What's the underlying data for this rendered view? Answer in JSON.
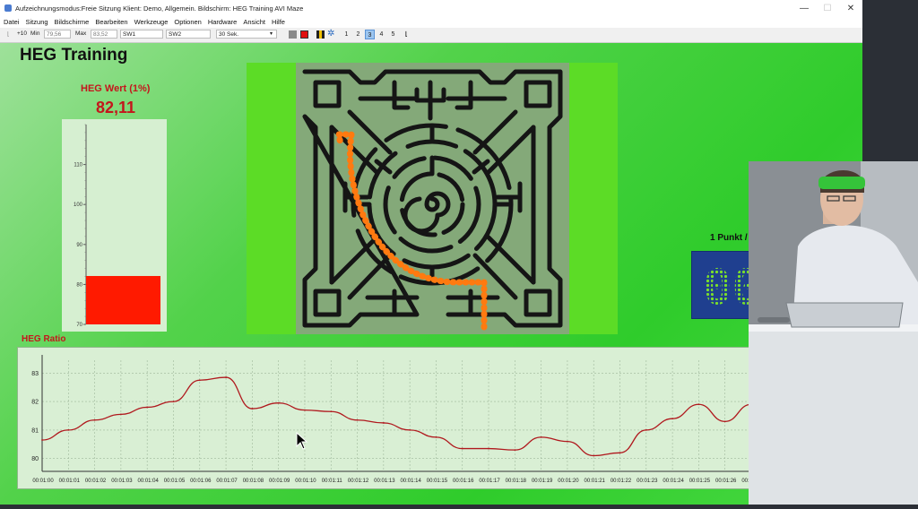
{
  "window": {
    "title": "Aufzeichnungsmodus:Freie Sitzung  Klient: Demo, Allgemein. Bildschirm: HEG Training AVI Maze",
    "controls": [
      "—",
      "☐",
      "✕"
    ]
  },
  "menu": [
    "Datei",
    "Sitzung",
    "Bildschirme",
    "Bearbeiten",
    "Werkzeuge",
    "Optionen",
    "Hardware",
    "Ansicht",
    "Hilfe"
  ],
  "toolbar": {
    "step_label": "+10",
    "min_label": "Min",
    "min_value": "79,56",
    "max_label": "Max",
    "max_value": "83,52",
    "sw1_value": "SW1",
    "sw2_value": "SW2",
    "interval_value": "30 Sek.",
    "screens": [
      "1",
      "2",
      "3",
      "4",
      "5"
    ],
    "active_screen": "3",
    "colors": {
      "gray_button": "#8a8a8a",
      "red_button": "#e01010",
      "yellow_button": "#f0c000",
      "gear": "#2a6ac0"
    }
  },
  "page": {
    "title": "HEG Training"
  },
  "heg": {
    "label": "HEG Wert (1%)",
    "value": "82,11",
    "bar": {
      "value": 82.11,
      "min": 70,
      "max": 120,
      "ticks": [
        "70",
        "80",
        "90",
        "100",
        "110"
      ],
      "color": "#ff1a00"
    }
  },
  "points": {
    "label": "1 Punkt / 10 Sec",
    "display": "000"
  },
  "maze": {
    "path_color": "#ff7a10",
    "wall_color": "#151515"
  },
  "chart_data": {
    "type": "line",
    "title": "HEG Ratio",
    "x": [
      "00:01:00",
      "00:01:01",
      "00:01:02",
      "00:01:03",
      "00:01:04",
      "00:01:05",
      "00:01:06",
      "00:01:07",
      "00:01:08",
      "00:01:09",
      "00:01:10",
      "00:01:11",
      "00:01:12",
      "00:01:13",
      "00:01:14",
      "00:01:15",
      "00:01:16",
      "00:01:17",
      "00:01:18",
      "00:01:19",
      "00:01:20",
      "00:01:21",
      "00:01:22",
      "00:01:23",
      "00:01:24",
      "00:01:25",
      "00:01:26",
      "00:01:27"
    ],
    "series": [
      {
        "values": [
          80.65,
          81.0,
          81.35,
          81.55,
          81.8,
          82.0,
          82.75,
          82.85,
          81.75,
          81.95,
          81.7,
          81.65,
          81.35,
          81.25,
          81.0,
          80.75,
          80.35,
          80.35,
          80.3,
          80.75,
          80.6,
          80.1,
          80.2,
          81.0,
          81.4,
          81.9,
          81.3,
          81.9
        ],
        "color": "#b0191e"
      }
    ],
    "yticks": [
      "80",
      "81",
      "82",
      "83"
    ],
    "ylim": [
      79.55,
      83.45
    ],
    "grid": true,
    "legend": "none"
  }
}
